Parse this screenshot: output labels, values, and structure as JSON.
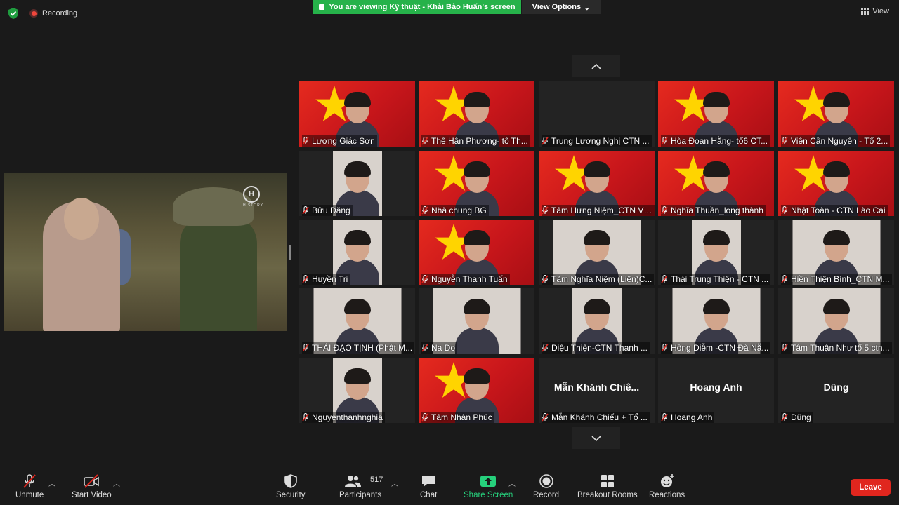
{
  "top": {
    "recording_label": "Recording",
    "viewing_banner": "You are viewing Kỹ thuật - Khải Bảo Huấn's screen",
    "view_options_label": "View Options",
    "view_label": "View"
  },
  "colors": {
    "accent_green": "#26b24a",
    "leave_red": "#e0261e",
    "flag_red": "#da251d",
    "star_yellow": "#ffd400"
  },
  "shared_screen": {
    "watermark": "HISTORY",
    "logo_letter": "H"
  },
  "participants": [
    {
      "name": "Lương Giác Sơn"
    },
    {
      "name": "Thể Hân Phương- tổ Th..."
    },
    {
      "name": "Trung Lương Nghị CTN ..."
    },
    {
      "name": "Hòa Đoan Hằng- tổ6 CT..."
    },
    {
      "name": "Viên Cần Nguyên - Tổ 2..."
    },
    {
      "name": "Bửu Đăng"
    },
    {
      "name": "Nhà chung BG"
    },
    {
      "name": "Tâm Hưng Niệm_CTN Vĩ..."
    },
    {
      "name": "Nghĩa Thuần_long thành"
    },
    {
      "name": "Nhật Toàn - CTN Lào Cai"
    },
    {
      "name": "Huyền Tri"
    },
    {
      "name": "Nguyễn Thanh Tuấn"
    },
    {
      "name": "Tâm Nghĩa Niệm (Liên)C..."
    },
    {
      "name": "Thái Trung Thiện - CTN ..."
    },
    {
      "name": "Hiền Thiện Bình_CTN M..."
    },
    {
      "name": "THÁI ĐẠO TỊNH (Phật M..."
    },
    {
      "name": "Na Do"
    },
    {
      "name": "Diệu Thiện-CTN Thanh ..."
    },
    {
      "name": "Hồng Diễm -CTN Đà Nẵ..."
    },
    {
      "name": "Tâm Thuận Như tổ 5 ctn..."
    },
    {
      "name": "Nguyenthanhnghia"
    },
    {
      "name": "Tâm Nhân Phúc"
    },
    {
      "name": "Mẫn Khánh Chiếu + Tổ ...",
      "display": "Mẫn Khánh Chiê..."
    },
    {
      "name": "Hoang Anh",
      "display": "Hoang Anh"
    },
    {
      "name": "Dũng",
      "display": "Dũng"
    }
  ],
  "toolbar": {
    "unmute": "Unmute",
    "start_video": "Start Video",
    "security": "Security",
    "participants": "Participants",
    "participant_count": "517",
    "chat": "Chat",
    "share_screen": "Share Screen",
    "record": "Record",
    "breakout_rooms": "Breakout Rooms",
    "reactions": "Reactions",
    "leave": "Leave"
  }
}
